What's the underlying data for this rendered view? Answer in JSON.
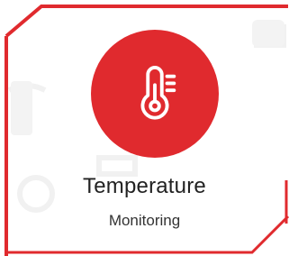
{
  "card": {
    "title": "Temperature",
    "subtitle": "Monitoring",
    "icon": "thermometer-icon",
    "accent_color": "#e02a2e",
    "frame_color": "#e02a2e"
  }
}
